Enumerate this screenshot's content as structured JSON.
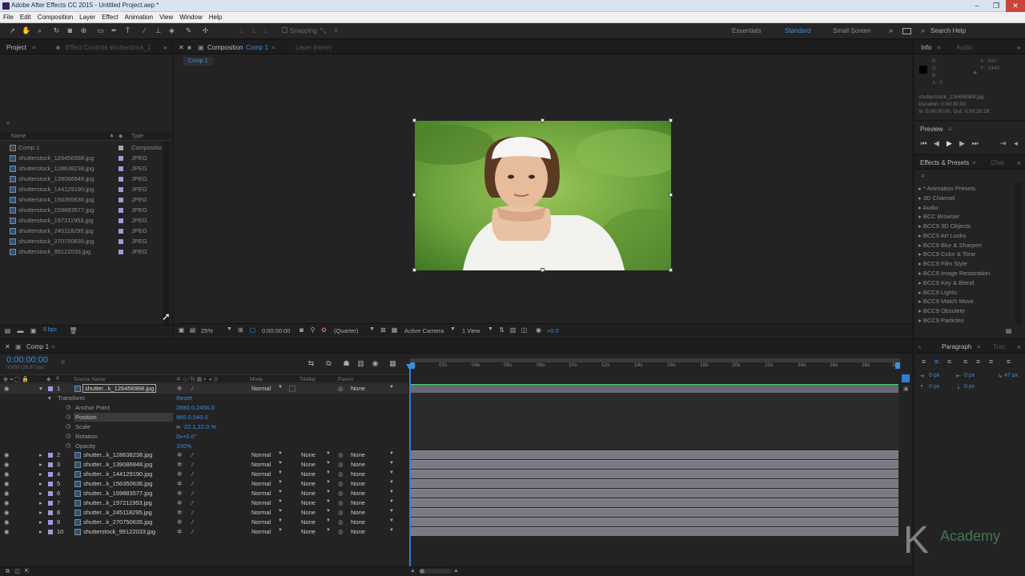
{
  "window": {
    "title": "Adobe After Effects CC 2015 - Untitled Project.aep *",
    "min": "–",
    "max": "❐",
    "close": "✕"
  },
  "menu": [
    "File",
    "Edit",
    "Composition",
    "Layer",
    "Effect",
    "Animation",
    "View",
    "Window",
    "Help"
  ],
  "toolbar": {
    "snapping": "Snapping",
    "workspaces": [
      "Essentials",
      "Standard",
      "Small Screen"
    ],
    "active_workspace": "Standard",
    "search_help": "Search Help"
  },
  "project": {
    "tab": "Project",
    "effect_controls_tab": "Effect Controls shutterstock_1",
    "col_name": "Name",
    "col_type": "Type",
    "items": [
      {
        "name": "Comp 1",
        "type": "Compositio"
      },
      {
        "name": "shutterstock_126456968.jpg",
        "type": "JPEG"
      },
      {
        "name": "shutterstock_128638238.jpg",
        "type": "JPEG"
      },
      {
        "name": "shutterstock_139086848.jpg",
        "type": "JPEG"
      },
      {
        "name": "shutterstock_144129190.jpg",
        "type": "JPEG"
      },
      {
        "name": "shutterstock_156350636.jpg",
        "type": "JPEG"
      },
      {
        "name": "shutterstock_159883577.jpg",
        "type": "JPEG"
      },
      {
        "name": "shutterstock_197211953.jpg",
        "type": "JPEG"
      },
      {
        "name": "shutterstock_245118295.jpg",
        "type": "JPEG"
      },
      {
        "name": "shutterstock_270750635.jpg",
        "type": "JPEG"
      },
      {
        "name": "shutterstock_99122033.jpg",
        "type": "JPEG"
      }
    ],
    "bpc": "8 bpc"
  },
  "comp_viewer": {
    "tab": "Composition",
    "tab_comp": "Comp 1",
    "layer_tab": "Layer (none)",
    "breadcrumb": "Comp 1",
    "zoom": "25%",
    "timecode": "0:00:00:00",
    "resolution": "(Quarter)",
    "camera": "Active Camera",
    "views": "1 View",
    "exposure": "+0.0"
  },
  "info": {
    "tab": "Info",
    "audio_tab": "Audio",
    "r": "R :",
    "g": "G :",
    "b": "B :",
    "a": "A : 0",
    "x": "X : 692",
    "y": "Y : 1440",
    "file": "shutterstock_126456968.jpg",
    "duration": "Duration: 0:00:30:00",
    "inout": "In: 0:00:00:00, Out: 0:00:29:29"
  },
  "preview": {
    "tab": "Preview"
  },
  "effects": {
    "tab": "Effects & Presets",
    "char_tab": "Char",
    "items": [
      "* Animation Presets",
      "3D Channel",
      "Audio",
      "BCC Browser",
      "BCC9 3D Objects",
      "BCC9 Art Looks",
      "BCC9 Blur & Sharpen",
      "BCC9 Color & Tone",
      "BCC9 Film Style",
      "BCC9 Image Restoration",
      "BCC9 Key & Blend",
      "BCC9 Lights",
      "BCC9 Match Move",
      "BCC9 Obsolete",
      "BCC9 Particles"
    ]
  },
  "paragraph": {
    "tab": "Paragraph",
    "tra_tab": "Trac",
    "px1": "0 px",
    "px2": "0 px",
    "px3": "0 px",
    "px4": "0 px",
    "px5": "0 px"
  },
  "timeline": {
    "tab": "Comp 1",
    "timecode": "0:00:00:00",
    "fps": "00000 (29.97 fps)",
    "col_source": "Source Name",
    "col_mode": "Mode",
    "col_trkmat": "TrkMat",
    "col_parent": "Parent",
    "ruler": [
      "0s",
      "02s",
      "04s",
      "06s",
      "08s",
      "10s",
      "12s",
      "14s",
      "16s",
      "18s",
      "20s",
      "22s",
      "24s",
      "26s",
      "28s",
      "30s"
    ],
    "transform": "Transform",
    "reset": "Reset",
    "props": [
      {
        "name": "Anchor Point",
        "value": "2880.0,2456.0"
      },
      {
        "name": "Position",
        "value": "960.0,540.0"
      },
      {
        "name": "Scale",
        "value": "22.1,22.0 %"
      },
      {
        "name": "Rotation",
        "value": "0x+0.0°"
      },
      {
        "name": "Opacity",
        "value": "100%"
      }
    ],
    "mode": "Normal",
    "none": "None",
    "layers": [
      {
        "num": "1",
        "name": "shutter...k_126456968.jpg"
      },
      {
        "num": "2",
        "name": "shutter...k_128638238.jpg"
      },
      {
        "num": "3",
        "name": "shutter...k_139086848.jpg"
      },
      {
        "num": "4",
        "name": "shutter...k_144129190.jpg"
      },
      {
        "num": "5",
        "name": "shutter...k_156350636.jpg"
      },
      {
        "num": "6",
        "name": "shutter...k_159883577.jpg"
      },
      {
        "num": "7",
        "name": "shutter...k_197211953.jpg"
      },
      {
        "num": "8",
        "name": "shutter...k_245118295.jpg"
      },
      {
        "num": "9",
        "name": "shutter...k_270750635.jpg"
      },
      {
        "num": "10",
        "name": "shutterstock_99122033.jpg"
      }
    ]
  },
  "watermark": {
    "letter": "K",
    "text": "Academy"
  },
  "colors": {
    "accent": "#3a8de0",
    "bg": "#232323",
    "layer_bar": "#7c7984",
    "label": "#a39ad8"
  }
}
